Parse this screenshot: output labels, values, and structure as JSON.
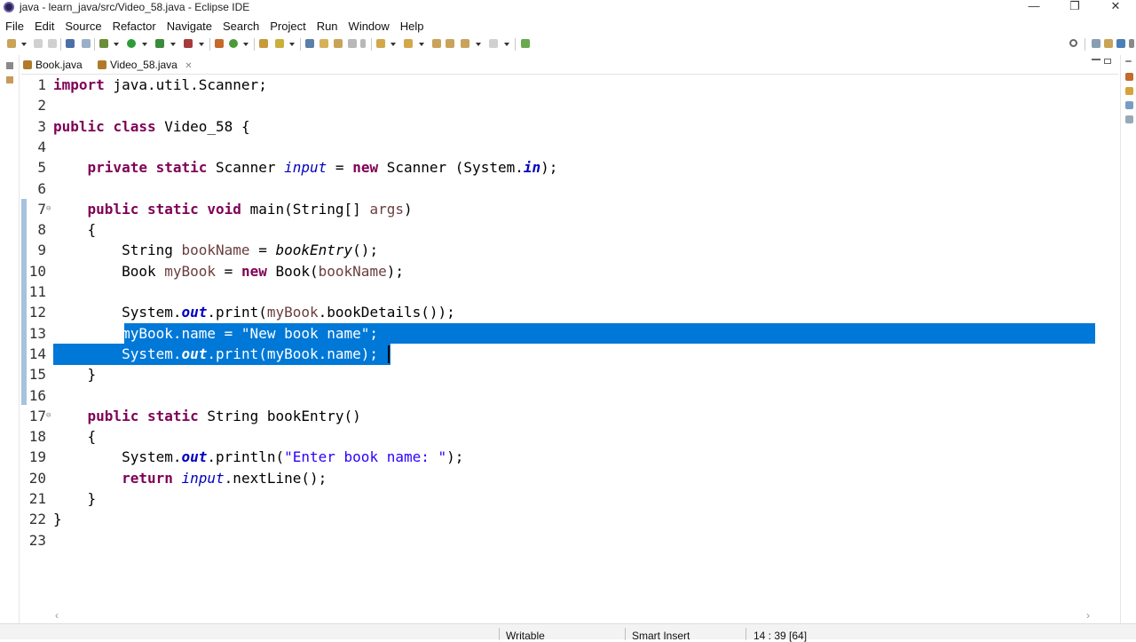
{
  "window": {
    "title": "java - learn_java/src/Video_58.java - Eclipse IDE",
    "minimize": "—",
    "restore": "❐",
    "close": "✕"
  },
  "menu": [
    "File",
    "Edit",
    "Source",
    "Refactor",
    "Navigate",
    "Search",
    "Project",
    "Run",
    "Window",
    "Help"
  ],
  "tabs": [
    {
      "label": "Book.java",
      "active": false
    },
    {
      "label": "Video_58.java",
      "active": true,
      "close": "✕"
    }
  ],
  "editor": {
    "lines": [
      {
        "n": "1",
        "tokens": [
          {
            "t": "import",
            "c": "kw"
          },
          {
            "t": " java.util.Scanner;"
          }
        ]
      },
      {
        "n": "2",
        "tokens": []
      },
      {
        "n": "3",
        "tokens": [
          {
            "t": "public",
            "c": "kw"
          },
          {
            "t": " "
          },
          {
            "t": "class",
            "c": "kw"
          },
          {
            "t": " Video_58 {"
          }
        ]
      },
      {
        "n": "4",
        "tokens": []
      },
      {
        "n": "5",
        "tokens": [
          {
            "t": "    "
          },
          {
            "t": "private",
            "c": "kw"
          },
          {
            "t": " "
          },
          {
            "t": "static",
            "c": "kw"
          },
          {
            "t": " Scanner "
          },
          {
            "t": "input",
            "c": "fld"
          },
          {
            "t": " = "
          },
          {
            "t": "new",
            "c": "kw"
          },
          {
            "t": " Scanner (System."
          },
          {
            "t": "in",
            "c": "sfld"
          },
          {
            "t": ");"
          }
        ]
      },
      {
        "n": "6",
        "tokens": []
      },
      {
        "n": "7",
        "tokens": [
          {
            "t": "    "
          },
          {
            "t": "public",
            "c": "kw"
          },
          {
            "t": " "
          },
          {
            "t": "static",
            "c": "kw"
          },
          {
            "t": " "
          },
          {
            "t": "void",
            "c": "kw"
          },
          {
            "t": " main(String[] "
          },
          {
            "t": "args",
            "c": "var"
          },
          {
            "t": ")"
          }
        ]
      },
      {
        "n": "8",
        "tokens": [
          {
            "t": "    {"
          }
        ]
      },
      {
        "n": "9",
        "tokens": [
          {
            "t": "        String "
          },
          {
            "t": "bookName",
            "c": "var"
          },
          {
            "t": " = "
          },
          {
            "t": "bookEntry",
            "c": "mth"
          },
          {
            "t": "();"
          }
        ]
      },
      {
        "n": "10",
        "tokens": [
          {
            "t": "        Book "
          },
          {
            "t": "myBook",
            "c": "var"
          },
          {
            "t": " = "
          },
          {
            "t": "new",
            "c": "kw"
          },
          {
            "t": " Book("
          },
          {
            "t": "bookName",
            "c": "var"
          },
          {
            "t": ");"
          }
        ]
      },
      {
        "n": "11",
        "tokens": []
      },
      {
        "n": "12",
        "tokens": [
          {
            "t": "        System."
          },
          {
            "t": "out",
            "c": "sfld"
          },
          {
            "t": ".print("
          },
          {
            "t": "myBook",
            "c": "var"
          },
          {
            "t": ".bookDetails());"
          }
        ]
      },
      {
        "n": "13",
        "tokens": [
          {
            "t": "        "
          },
          {
            "t": "myBook.name = \"New book name\";",
            "c": "sel-text"
          }
        ]
      },
      {
        "n": "14",
        "tokens": [
          {
            "t": "        System.",
            "c": "sel-text"
          },
          {
            "t": "out",
            "c": "sel-text sfldw"
          },
          {
            "t": ".print(myBook.name);",
            "c": "sel-text"
          }
        ]
      },
      {
        "n": "15",
        "tokens": [
          {
            "t": "    }"
          }
        ]
      },
      {
        "n": "16",
        "tokens": []
      },
      {
        "n": "17",
        "tokens": [
          {
            "t": "    "
          },
          {
            "t": "public",
            "c": "kw"
          },
          {
            "t": " "
          },
          {
            "t": "static",
            "c": "kw"
          },
          {
            "t": " String bookEntry()"
          }
        ]
      },
      {
        "n": "18",
        "tokens": [
          {
            "t": "    {"
          }
        ]
      },
      {
        "n": "19",
        "tokens": [
          {
            "t": "        System."
          },
          {
            "t": "out",
            "c": "sfld"
          },
          {
            "t": ".println("
          },
          {
            "t": "\"Enter book name: \"",
            "c": "str"
          },
          {
            "t": ");"
          }
        ]
      },
      {
        "n": "20",
        "tokens": [
          {
            "t": "        "
          },
          {
            "t": "return",
            "c": "kw"
          },
          {
            "t": " "
          },
          {
            "t": "input",
            "c": "fld"
          },
          {
            "t": ".nextLine();"
          }
        ]
      },
      {
        "n": "21",
        "tokens": [
          {
            "t": "    }"
          }
        ]
      },
      {
        "n": "22",
        "tokens": [
          {
            "t": "}"
          }
        ]
      },
      {
        "n": "23",
        "tokens": []
      }
    ],
    "fold_marker": "⊖"
  },
  "status": {
    "writable": "Writable",
    "insert_mode": "Smart Insert",
    "position": "14 : 39 [64]"
  },
  "colors": {
    "selection": "#0078d7",
    "keyword": "#7f0055",
    "field": "#0000c0",
    "string": "#2a00ff",
    "local_var": "#6a3e3e"
  }
}
